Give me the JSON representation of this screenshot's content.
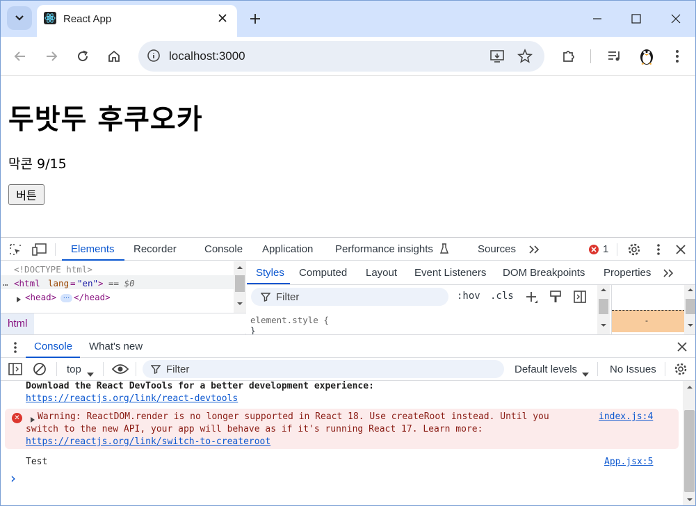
{
  "browser": {
    "tab_title": "React App",
    "url": "localhost:3000"
  },
  "page": {
    "heading": "두밧두 후쿠오카",
    "paragraph": "막콘 9/15",
    "button_label": "버튼"
  },
  "devtools": {
    "tabs": [
      "Elements",
      "Recorder",
      "Console",
      "Application",
      "Performance insights",
      "Sources"
    ],
    "active_tab": "Elements",
    "error_count": "1",
    "elements": {
      "doctype": "<!DOCTYPE html>",
      "html_open": "<html",
      "html_attr_name": "lang",
      "html_attr_value": "\"en\"",
      "html_close_bracket": ">",
      "dollar0": "== $0",
      "head_open": "<head>",
      "head_close": "</head>",
      "ellipsis": "…",
      "breadcrumb": "html"
    },
    "styles_tabs": [
      "Styles",
      "Computed",
      "Layout",
      "Event Listeners",
      "DOM Breakpoints",
      "Properties"
    ],
    "styles": {
      "filter_placeholder": "Filter",
      "hov": ":hov",
      ".cls": ".cls",
      "element_style": "element.style {",
      "closing_brace": "}",
      "box_model_value": "-"
    },
    "drawer_tabs": [
      "Console",
      "What's new"
    ],
    "console_bar": {
      "context": "top",
      "filter_placeholder": "Filter",
      "levels": "Default levels",
      "issues": "No Issues"
    },
    "console_messages": {
      "devtools_msg": "Download the React DevTools for a better development experience:",
      "devtools_link": "https://reactjs.org/link/react-devtools",
      "warning_line1": "Warning: ReactDOM.render is no longer supported in React 18. Use createRoot instead. Until you",
      "warning_line2": "switch to the new API, your app will behave as if it's running React 17. Learn more:",
      "warning_link": "https://reactjs.org/link/switch-to-createroot",
      "warning_source": "index.js:4",
      "log_text": "Test",
      "log_source": "App.jsx:5",
      "prompt": "›"
    }
  }
}
